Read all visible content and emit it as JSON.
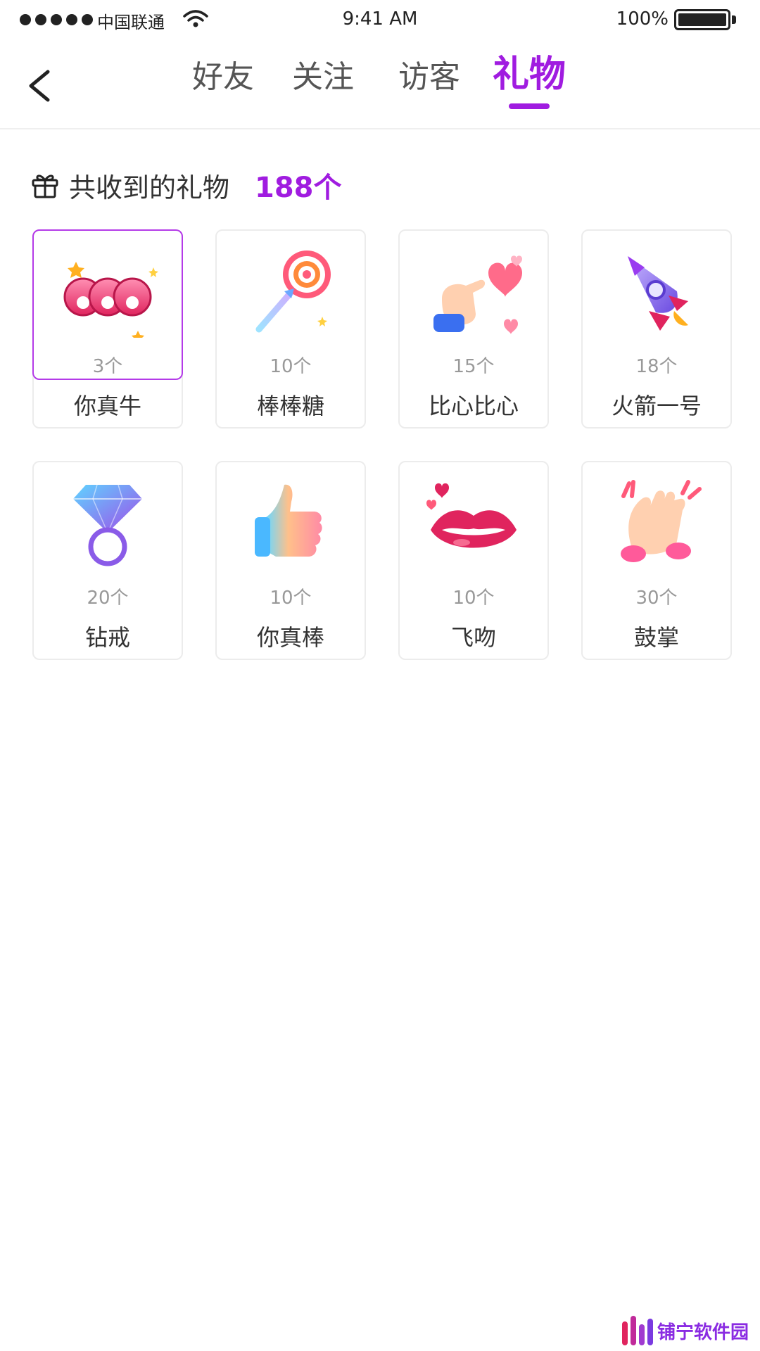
{
  "status_bar": {
    "carrier": "中国联通",
    "time": "9:41 AM",
    "battery": "100%"
  },
  "nav": {
    "tabs": [
      {
        "label": "好友"
      },
      {
        "label": "关注"
      },
      {
        "label": "访客"
      },
      {
        "label": "礼物"
      }
    ],
    "active_tab": "礼物",
    "accent_color": "#a01ce0"
  },
  "summary": {
    "label": "共收到的礼物",
    "count": "188个"
  },
  "gifts": [
    {
      "name": "你真牛",
      "count": "3个",
      "icon": "666-icon"
    },
    {
      "name": "棒棒糖",
      "count": "10个",
      "icon": "lollipop-icon"
    },
    {
      "name": "比心比心",
      "count": "15个",
      "icon": "finger-heart-icon"
    },
    {
      "name": "火箭一号",
      "count": "18个",
      "icon": "rocket-icon"
    },
    {
      "name": "钻戒",
      "count": "20个",
      "icon": "diamond-ring-icon"
    },
    {
      "name": "你真棒",
      "count": "10个",
      "icon": "thumbs-up-icon"
    },
    {
      "name": "飞吻",
      "count": "10个",
      "icon": "kiss-lips-icon"
    },
    {
      "name": "鼓掌",
      "count": "30个",
      "icon": "clapping-hands-icon"
    }
  ],
  "watermark": {
    "text": "铺宁软件园"
  }
}
